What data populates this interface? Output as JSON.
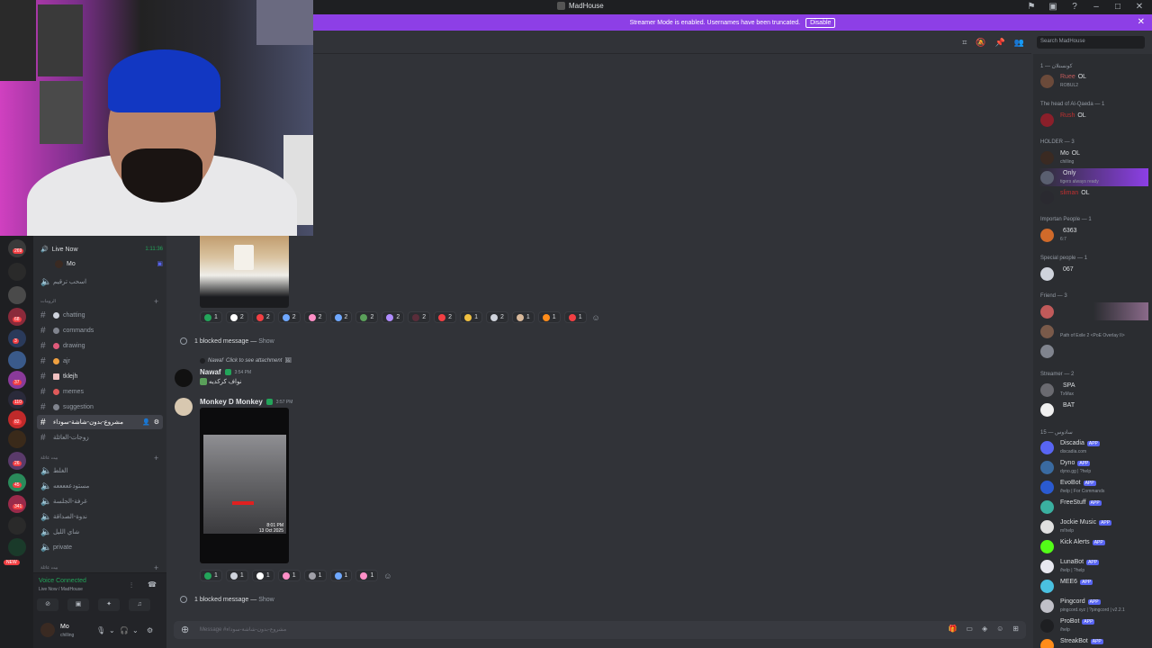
{
  "window": {
    "title": "MadHouse"
  },
  "banner": {
    "text": "Streamer Mode is enabled. Usernames have been truncated.",
    "disable_label": "Disable"
  },
  "search": {
    "placeholder": "Search MadHouse"
  },
  "sidebar": {
    "live_channel": "Live Now",
    "live_timer": "1:11:36",
    "live_user": "Mo",
    "voice_channel_row": "اسحب ترقيم",
    "category_1": "الرومات",
    "channels": [
      {
        "label": "chatting"
      },
      {
        "label": "commands"
      },
      {
        "label": "drawing"
      },
      {
        "label": "ajr"
      },
      {
        "label": "tklejh"
      },
      {
        "label": "memes"
      },
      {
        "label": "suggestion"
      },
      {
        "label": "مشروع-بدون-شاشة-سوداء"
      },
      {
        "label": "زوجات-العائلة"
      }
    ],
    "category_2": "بيت عائلة",
    "voice_rooms": [
      {
        "label": "الغلط"
      },
      {
        "label": "مستودعععععه"
      },
      {
        "label": "غرفة-الجلسة"
      },
      {
        "label": "ندوة-الصداقة"
      },
      {
        "label": "شاي الليل"
      },
      {
        "label": "private"
      }
    ],
    "category_3": "بيت عائلة"
  },
  "rail": {
    "badges": [
      "269",
      "68",
      "3",
      "37",
      "110",
      "82",
      "26",
      "45",
      "341"
    ],
    "new_label": "NEW"
  },
  "voice_panel": {
    "status": "Voice Connected",
    "channel": "Live Now / MadHouse"
  },
  "user_panel": {
    "name": "Mo",
    "status": "chilling"
  },
  "chat": {
    "reactions_1": [
      {
        "emoji": "check",
        "count": "1",
        "color": "#23a55a"
      },
      {
        "emoji": "white-heart",
        "count": "2",
        "color": "#ffffff"
      },
      {
        "emoji": "red-heart",
        "count": "2",
        "color": "#f23f43"
      },
      {
        "emoji": "blue-heart",
        "count": "2",
        "color": "#6fa8ff"
      },
      {
        "emoji": "pink-heart",
        "count": "2",
        "color": "#ff8fc7"
      },
      {
        "emoji": "blue-heart",
        "count": "2",
        "color": "#6fa8ff"
      },
      {
        "emoji": "turtle",
        "count": "2",
        "color": "#5aa05a"
      },
      {
        "emoji": "purple-heart",
        "count": "2",
        "color": "#b08cff"
      },
      {
        "emoji": "dark-heart",
        "count": "2",
        "color": "#5a2d3a"
      },
      {
        "emoji": "heart-face",
        "count": "2",
        "color": "#f23f43"
      },
      {
        "emoji": "worried-face",
        "count": "1",
        "color": "#f0c040"
      },
      {
        "emoji": "goat",
        "count": "2",
        "color": "#cfd3dc"
      },
      {
        "emoji": "pepe",
        "count": "1",
        "color": "#d8b89a"
      },
      {
        "emoji": "fire",
        "count": "1",
        "color": "#ff8c1a"
      },
      {
        "emoji": "cross",
        "count": "1",
        "color": "#f23f43"
      }
    ],
    "blocked_1": "1 blocked message —",
    "show_label": "Show",
    "reply_author": "Nawaf",
    "reply_text": "Click to see attachment",
    "msg1": {
      "author": "Nawaf",
      "time": "3:54 PM",
      "text": "نواف كركديه"
    },
    "msg2": {
      "author": "Monkey D Monkey",
      "time": "3:57 PM"
    },
    "video_timestamp": "8:01 PM",
    "video_date": "13 Oct 2025",
    "reactions_2": [
      {
        "emoji": "check",
        "count": "1",
        "color": "#23a55a"
      },
      {
        "emoji": "goat",
        "count": "1",
        "color": "#cfd3dc"
      },
      {
        "emoji": "white-heart",
        "count": "1",
        "color": "#ffffff"
      },
      {
        "emoji": "pink-heart",
        "count": "1",
        "color": "#ff8fc7"
      },
      {
        "emoji": "grey-heart",
        "count": "1",
        "color": "#a0a0a8"
      },
      {
        "emoji": "blue-heart",
        "count": "1",
        "color": "#6fa8ff"
      },
      {
        "emoji": "pink-heart",
        "count": "1",
        "color": "#ff8fc7"
      }
    ],
    "blocked_2": "1 blocked message —",
    "composer_placeholder": "Message #مشروع-بدون-شاشة-سوداء"
  },
  "members": {
    "groups": [
      {
        "label": "كونستلان — 1"
      },
      {
        "label": "The head of Al-Qaeda — 1"
      },
      {
        "label": "HOLDER — 3"
      },
      {
        "label": "Importan People — 1"
      },
      {
        "label": "Special people — 1"
      },
      {
        "label": "Friend — 3"
      },
      {
        "label": "Streamer — 2"
      },
      {
        "label": "سادوس — 15"
      }
    ],
    "list": [
      {
        "name": "Ruee",
        "tag": "OL",
        "status": "ROBUL2",
        "color": "#6b4a3a"
      },
      {
        "name": "Rush",
        "tag": "OL",
        "status": "",
        "color": "#8a1f2a"
      },
      {
        "name": "Mo",
        "tag": "OL",
        "status": "chilling",
        "color": "#3a2a22"
      },
      {
        "name": "",
        "tag": "Only",
        "status": "tigers always ready",
        "color": "#5a5f70"
      },
      {
        "name": "sliman",
        "tag": "OL",
        "status": "",
        "color": "#2a2a30"
      },
      {
        "name": "",
        "tag": "6363",
        "status": "6:7",
        "color": "#d06a2a"
      },
      {
        "name": "",
        "tag": "067",
        "status": "",
        "color": "#cfd3dc"
      },
      {
        "name": "",
        "tag": "",
        "status": "",
        "color": "#c05a5a"
      },
      {
        "name": "",
        "tag": "",
        "status": "Path of Exile 2 <PoE Overlay II>",
        "color": "#7a5a4a"
      },
      {
        "name": "",
        "tag": "",
        "status": "",
        "color": "#80848e"
      },
      {
        "name": "",
        "tag": "SPA",
        "status": "TxMax",
        "color": "#6a6a70"
      },
      {
        "name": "",
        "tag": "BAT",
        "status": "",
        "color": "#f0f0f0"
      }
    ],
    "bots": [
      {
        "name": "Discadia",
        "status": "discadia.com",
        "color": "#5865f2"
      },
      {
        "name": "Dyno",
        "status": "dyno.gg | ?help",
        "color": "#3a6aa0"
      },
      {
        "name": "EvoBot",
        "status": "/help | For Commands",
        "color": "#2a5ad0"
      },
      {
        "name": "FreeStuff",
        "status": "",
        "color": "#3ab0a0"
      },
      {
        "name": "Jockie Music",
        "status": "m!help",
        "color": "#e0e0e0"
      },
      {
        "name": "Kick Alerts",
        "status": "",
        "color": "#53fc18"
      },
      {
        "name": "LunaBot",
        "status": "/help | ?help",
        "color": "#e8e8f0"
      },
      {
        "name": "MEE6",
        "status": "",
        "color": "#4ac0e0"
      },
      {
        "name": "Pingcord",
        "status": "pingcord.xyz | ?pingcord | v2.2.1",
        "color": "#c0c0c8"
      },
      {
        "name": "ProBot",
        "status": "/help",
        "color": "#1e1f22"
      },
      {
        "name": "StreakBot",
        "status": "",
        "color": "#ff8c1a"
      }
    ],
    "app_label": "APP"
  }
}
